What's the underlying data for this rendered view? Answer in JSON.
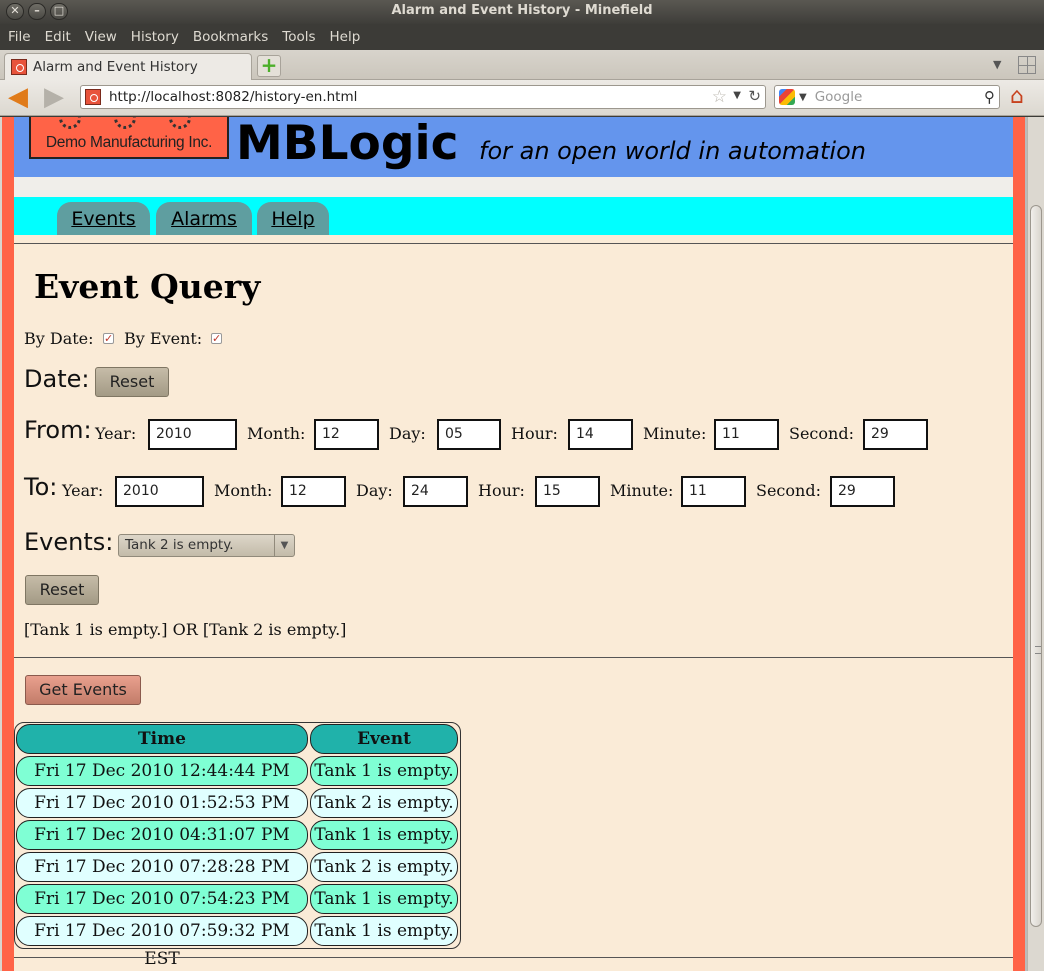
{
  "window": {
    "title": "Alarm and Event History - Minefield",
    "buttons": [
      "✕",
      "–",
      "□"
    ]
  },
  "menubar": [
    "File",
    "Edit",
    "View",
    "History",
    "Bookmarks",
    "Tools",
    "Help"
  ],
  "browser": {
    "tab_title": "Alarm and Event History",
    "new_tab": "+",
    "url": "http://localhost:8082/history-en.html",
    "search_placeholder": "Google"
  },
  "site": {
    "logo_text": "Demo Manufacturing Inc.",
    "title": "MBLogic",
    "tagline": "for an open world in automation",
    "nav": [
      "Events",
      "Alarms",
      "Help"
    ]
  },
  "query": {
    "heading": "Event Query",
    "by_date_label": "By Date:",
    "by_event_label": "By Event:",
    "date_label": "Date:",
    "reset_label": "Reset",
    "from_label": "From:",
    "to_label": "To:",
    "field_labels": {
      "year": "Year:",
      "month": "Month:",
      "day": "Day:",
      "hour": "Hour:",
      "minute": "Minute:",
      "second": "Second:"
    },
    "from": {
      "year": "2010",
      "month": "12",
      "day": "05",
      "hour": "14",
      "minute": "11",
      "second": "29"
    },
    "to": {
      "year": "2010",
      "month": "12",
      "day": "24",
      "hour": "15",
      "minute": "11",
      "second": "29"
    },
    "events_label": "Events:",
    "events_selected": "Tank 2 is empty.",
    "events_reset_label": "Reset",
    "selection_summary": "[Tank 1 is empty.] OR [Tank 2 is empty.]",
    "get_events_label": "Get Events"
  },
  "results": {
    "columns": [
      "Time",
      "Event"
    ],
    "rows": [
      [
        "Fri 17 Dec 2010 12:44:44 PM EST",
        "Tank 1 is empty."
      ],
      [
        "Fri 17 Dec 2010 01:52:53 PM EST",
        "Tank 2 is empty."
      ],
      [
        "Fri 17 Dec 2010 04:31:07 PM EST",
        "Tank 1 is empty."
      ],
      [
        "Fri 17 Dec 2010 07:28:28 PM EST",
        "Tank 2 is empty."
      ],
      [
        "Fri 17 Dec 2010 07:54:23 PM EST",
        "Tank 1 is empty."
      ],
      [
        "Fri 17 Dec 2010 07:59:32 PM EST",
        "Tank 1 is empty."
      ]
    ]
  },
  "colors": {
    "header": "#6495ed",
    "nav_band": "#00ffff",
    "nav_tab": "#5f9ea0",
    "page_bg": "#faebd7",
    "side_bars": "#ff6347",
    "table_header": "#20b2aa",
    "row_even": "#7fffd4",
    "row_odd": "#e0ffff"
  }
}
